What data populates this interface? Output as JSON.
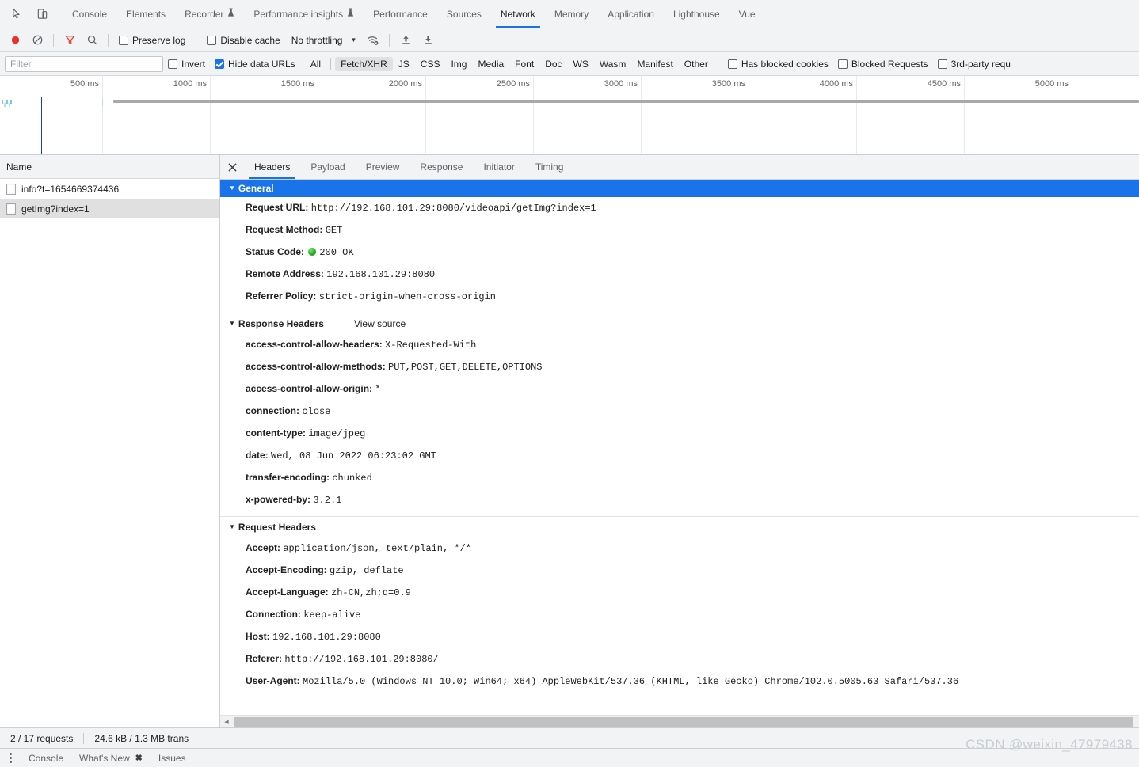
{
  "tabstrip": {
    "inspect_icon": "inspect-cursor-icon",
    "device_icon": "device-toolbar-icon",
    "tabs": [
      {
        "label": "Console",
        "active": false,
        "flask": false
      },
      {
        "label": "Elements",
        "active": false,
        "flask": false
      },
      {
        "label": "Recorder",
        "active": false,
        "flask": true
      },
      {
        "label": "Performance insights",
        "active": false,
        "flask": true
      },
      {
        "label": "Performance",
        "active": false,
        "flask": false
      },
      {
        "label": "Sources",
        "active": false,
        "flask": false
      },
      {
        "label": "Network",
        "active": true,
        "flask": false
      },
      {
        "label": "Memory",
        "active": false,
        "flask": false
      },
      {
        "label": "Application",
        "active": false,
        "flask": false
      },
      {
        "label": "Lighthouse",
        "active": false,
        "flask": false
      },
      {
        "label": "Vue",
        "active": false,
        "flask": false
      }
    ],
    "flask_glyph": "⚗"
  },
  "toolbar": {
    "record_icon": "record-button-icon",
    "clear_icon": "clear-icon",
    "filter_icon": "filter-funnel-icon",
    "search_icon": "search-icon",
    "preserve_log_label": "Preserve log",
    "preserve_log_checked": false,
    "disable_cache_label": "Disable cache",
    "disable_cache_checked": false,
    "throttling_label": "No throttling",
    "caret_glyph": "▼",
    "network_conditions_icon": "wifi-settings-icon",
    "import_icon": "import-har-icon",
    "export_icon": "export-har-icon",
    "record_color": "#e8342a",
    "filter_color": "#e8342a"
  },
  "filterbar": {
    "filter_placeholder": "Filter",
    "filter_value": "",
    "invert_label": "Invert",
    "invert_checked": false,
    "hide_data_urls_label": "Hide data URLs",
    "hide_data_urls_checked": true,
    "types": [
      {
        "label": "All",
        "selected": false
      },
      {
        "label": "Fetch/XHR",
        "selected": true
      },
      {
        "label": "JS",
        "selected": false
      },
      {
        "label": "CSS",
        "selected": false
      },
      {
        "label": "Img",
        "selected": false
      },
      {
        "label": "Media",
        "selected": false
      },
      {
        "label": "Font",
        "selected": false
      },
      {
        "label": "Doc",
        "selected": false
      },
      {
        "label": "WS",
        "selected": false
      },
      {
        "label": "Wasm",
        "selected": false
      },
      {
        "label": "Manifest",
        "selected": false
      },
      {
        "label": "Other",
        "selected": false
      }
    ],
    "has_blocked_cookies_label": "Has blocked cookies",
    "has_blocked_cookies_checked": false,
    "blocked_requests_label": "Blocked Requests",
    "blocked_requests_checked": false,
    "third_party_label": "3rd-party requ",
    "third_party_checked": false
  },
  "overview": {
    "ticks": [
      "500 ms",
      "1000 ms",
      "1500 ms",
      "2000 ms",
      "2500 ms",
      "3000 ms",
      "3500 ms",
      "4000 ms",
      "4500 ms",
      "5000 ms"
    ],
    "dom_content_loaded_color": "#1d3bbf",
    "request_bar_color": "#a9a9a9"
  },
  "requests": {
    "column_header": "Name",
    "rows": [
      {
        "name": "info?t=1654669374436",
        "selected": false
      },
      {
        "name": "getImg?index=1",
        "selected": true
      }
    ]
  },
  "detail": {
    "close_icon": "close-icon",
    "tabs": [
      {
        "label": "Headers",
        "active": true
      },
      {
        "label": "Payload",
        "active": false
      },
      {
        "label": "Preview",
        "active": false
      },
      {
        "label": "Response",
        "active": false
      },
      {
        "label": "Initiator",
        "active": false
      },
      {
        "label": "Timing",
        "active": false
      }
    ],
    "general": {
      "title": "General",
      "items": [
        {
          "key": "Request URL:",
          "value": "http://192.168.101.29:8080/videoapi/getImg?index=1",
          "status": false
        },
        {
          "key": "Request Method:",
          "value": "GET",
          "status": false
        },
        {
          "key": "Status Code:",
          "value": "200 OK",
          "status": true
        },
        {
          "key": "Remote Address:",
          "value": "192.168.101.29:8080",
          "status": false
        },
        {
          "key": "Referrer Policy:",
          "value": "strict-origin-when-cross-origin",
          "status": false
        }
      ]
    },
    "response_headers": {
      "title": "Response Headers",
      "view_source": "View source",
      "items": [
        {
          "key": "access-control-allow-headers:",
          "value": "X-Requested-With"
        },
        {
          "key": "access-control-allow-methods:",
          "value": "PUT,POST,GET,DELETE,OPTIONS"
        },
        {
          "key": "access-control-allow-origin:",
          "value": "*"
        },
        {
          "key": "connection:",
          "value": "close"
        },
        {
          "key": "content-type:",
          "value": "image/jpeg"
        },
        {
          "key": "date:",
          "value": "Wed, 08 Jun 2022 06:23:02 GMT"
        },
        {
          "key": "transfer-encoding:",
          "value": "chunked"
        },
        {
          "key": "x-powered-by:",
          "value": "3.2.1"
        }
      ]
    },
    "request_headers": {
      "title": "Request Headers",
      "items": [
        {
          "key": "Accept:",
          "value": "application/json, text/plain, */*"
        },
        {
          "key": "Accept-Encoding:",
          "value": "gzip, deflate"
        },
        {
          "key": "Accept-Language:",
          "value": "zh-CN,zh;q=0.9"
        },
        {
          "key": "Connection:",
          "value": "keep-alive"
        },
        {
          "key": "Host:",
          "value": "192.168.101.29:8080"
        },
        {
          "key": "Referer:",
          "value": "http://192.168.101.29:8080/"
        },
        {
          "key": "User-Agent:",
          "value": "Mozilla/5.0 (Windows NT 10.0; Win64; x64) AppleWebKit/537.36 (KHTML, like Gecko) Chrome/102.0.5005.63 Safari/537.36"
        }
      ]
    }
  },
  "statusbar": {
    "requests": "2 / 17 requests",
    "transferred": "24.6 kB / 1.3 MB trans"
  },
  "drawer": {
    "menu_icon": "more-options-icon",
    "tabs": [
      {
        "label": "Console",
        "closable": false
      },
      {
        "label": "What's New",
        "closable": true
      },
      {
        "label": "Issues",
        "closable": false
      }
    ],
    "close_glyph": "✖"
  },
  "watermark": "CSDN @weixin_47979438"
}
